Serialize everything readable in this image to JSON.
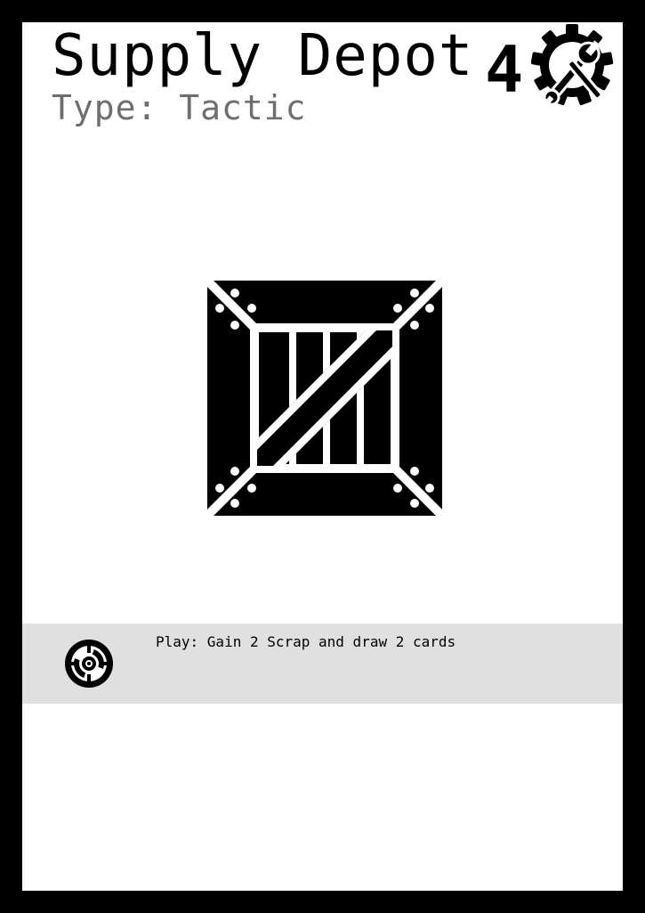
{
  "card": {
    "title": "Supply Depot",
    "type_line": "Type: Tactic",
    "cost": "4",
    "cost_icon": "gear-wrench-icon",
    "art_icon": "wooden-crate-icon",
    "ability": {
      "icon": "target-play-icon",
      "text": "Play: Gain 2 Scrap and draw 2 cards"
    }
  },
  "colors": {
    "border": "#000000",
    "card_background": "#ffffff",
    "ability_background": "#e0e0e0",
    "type_text": "#6e6e6e"
  }
}
